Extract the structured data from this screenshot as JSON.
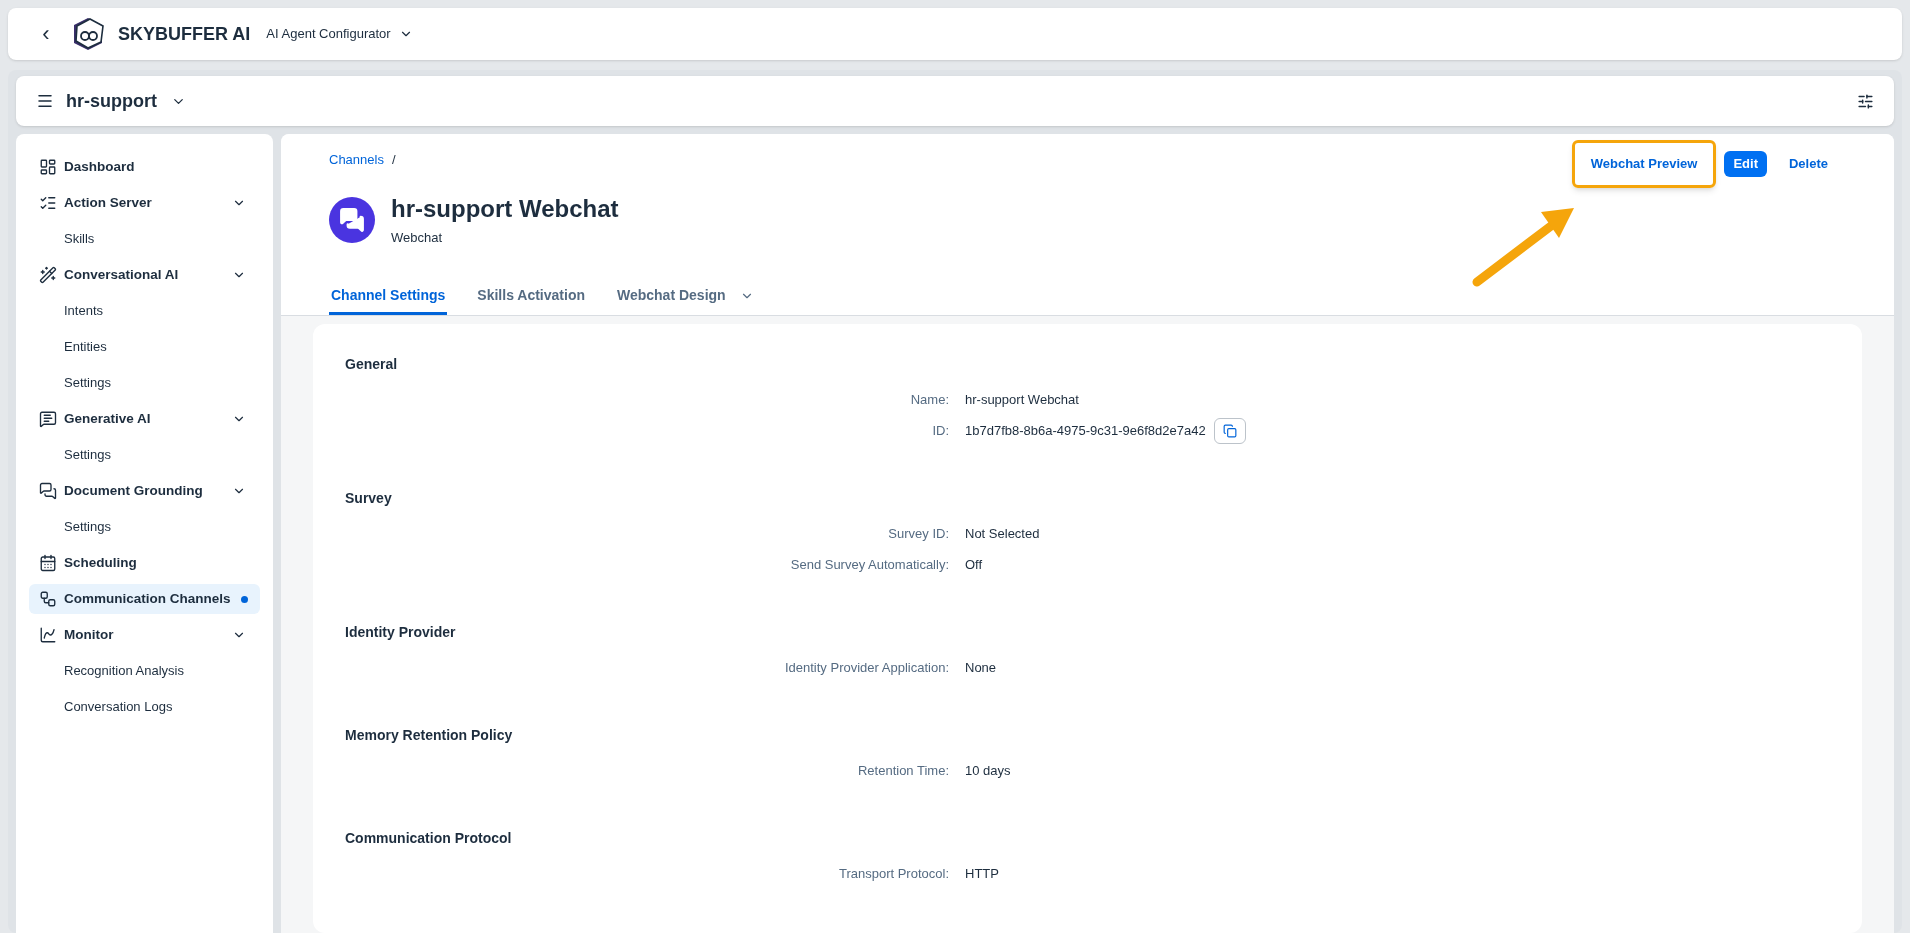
{
  "shell": {
    "back": "‹",
    "brand": "SKYBUFFER AI",
    "app": "AI Agent Configurator"
  },
  "workspace": {
    "name": "hr-support"
  },
  "sidebar": {
    "items": [
      {
        "label": "Dashboard",
        "selected": false,
        "indicator": false
      },
      {
        "label": "Action Server",
        "selected": false,
        "indicator": false,
        "expanded": true,
        "children": [
          {
            "label": "Skills",
            "selected": false
          }
        ]
      },
      {
        "label": "Conversational AI",
        "selected": false,
        "indicator": false,
        "expanded": true,
        "children": [
          {
            "label": "Intents",
            "selected": false
          },
          {
            "label": "Entities",
            "selected": false
          },
          {
            "label": "Settings",
            "selected": false
          }
        ]
      },
      {
        "label": "Generative AI",
        "selected": false,
        "indicator": false,
        "expanded": true,
        "children": [
          {
            "label": "Settings",
            "selected": false
          }
        ]
      },
      {
        "label": "Document Grounding",
        "selected": false,
        "indicator": false,
        "expanded": true,
        "children": [
          {
            "label": "Settings",
            "selected": false
          }
        ]
      },
      {
        "label": "Scheduling",
        "selected": false,
        "indicator": false
      },
      {
        "label": "Communication Channels",
        "selected": true,
        "indicator": true
      },
      {
        "label": "Monitor",
        "selected": false,
        "indicator": false,
        "expanded": true,
        "children": [
          {
            "label": "Recognition Analysis",
            "selected": false
          },
          {
            "label": "Conversation Logs",
            "selected": false
          }
        ]
      }
    ]
  },
  "breadcrumb": {
    "link": "Channels",
    "separator": "/"
  },
  "channel": {
    "title": "hr-support Webchat",
    "subtitle": "Webchat"
  },
  "actions": [
    {
      "label": "Webchat Preview",
      "kind": "ghost",
      "highlighted": true
    },
    {
      "label": "Edit",
      "kind": "primary",
      "highlighted": false
    },
    {
      "label": "Delete",
      "kind": "ghost",
      "highlighted": false
    }
  ],
  "tabs": [
    {
      "label": "Channel Settings",
      "selected": true,
      "menu": false
    },
    {
      "label": "Skills Activation",
      "selected": false,
      "menu": false
    },
    {
      "label": "Webchat Design",
      "selected": false,
      "menu": true
    }
  ],
  "sections": [
    {
      "title": "General",
      "fields": [
        {
          "label": "Name:",
          "value": "hr-support Webchat",
          "copyable": false
        },
        {
          "label": "ID:",
          "value": "1b7d7fb8-8b6a-4975-9c31-9e6f8d2e7a42",
          "copyable": true
        }
      ]
    },
    {
      "title": "Survey",
      "fields": [
        {
          "label": "Survey ID:",
          "value": "Not Selected",
          "copyable": false
        },
        {
          "label": "Send Survey Automatically:",
          "value": "Off",
          "copyable": false
        }
      ]
    },
    {
      "title": "Identity Provider",
      "fields": [
        {
          "label": "Identity Provider Application:",
          "value": "None",
          "copyable": false
        }
      ]
    },
    {
      "title": "Memory Retention Policy",
      "fields": [
        {
          "label": "Retention Time:",
          "value": "10 days",
          "copyable": false
        }
      ]
    },
    {
      "title": "Communication Protocol",
      "fields": [
        {
          "label": "Transport Protocol:",
          "value": "HTTP",
          "copyable": false
        }
      ]
    }
  ]
}
